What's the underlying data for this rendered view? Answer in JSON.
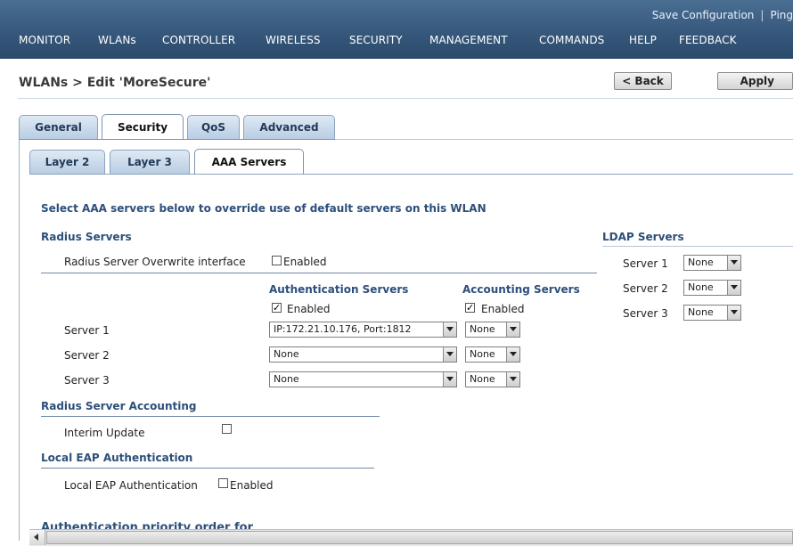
{
  "header": {
    "save_configuration": "Save Configuration",
    "separator": "|",
    "ping": "Ping"
  },
  "menu": [
    "MONITOR",
    "WLANs",
    "CONTROLLER",
    "WIRELESS",
    "SECURITY",
    "MANAGEMENT",
    "COMMANDS",
    "HELP",
    "FEEDBACK"
  ],
  "page": {
    "title": "WLANs > Edit  'MoreSecure'",
    "back_label": "< Back",
    "apply_label": "Apply"
  },
  "tabs": {
    "main": [
      "General",
      "Security",
      "QoS",
      "Advanced"
    ],
    "main_selected": "Security",
    "sub": [
      "Layer 2",
      "Layer 3",
      "AAA Servers"
    ],
    "sub_selected": "AAA Servers"
  },
  "content": {
    "intro": "Select AAA servers below to override use of default servers on this WLAN",
    "radius_title": "Radius Servers",
    "overwrite_label": "Radius Server Overwrite interface",
    "overwrite_checkbox_label": "Enabled",
    "overwrite_checked": false,
    "auth_header": "Authentication Servers",
    "acct_header": "Accounting Servers",
    "auth_enabled_label": "Enabled",
    "auth_enabled_checked": true,
    "acct_enabled_label": "Enabled",
    "acct_enabled_checked": true,
    "servers": [
      {
        "label": "Server 1",
        "auth": "IP:172.21.10.176, Port:1812",
        "acct": "None"
      },
      {
        "label": "Server 2",
        "auth": "None",
        "acct": "None"
      },
      {
        "label": "Server 3",
        "auth": "None",
        "acct": "None"
      }
    ],
    "accounting_title": "Radius Server Accounting",
    "interim_label": "Interim Update",
    "interim_checked": false,
    "eap_title": "Local EAP Authentication",
    "eap_label": "Local EAP Authentication",
    "eap_checkbox_label": "Enabled",
    "eap_checked": false,
    "priority_title": "Authentication priority order for",
    "ldap_title": "LDAP Servers",
    "ldap": [
      {
        "label": "Server 1",
        "value": "None"
      },
      {
        "label": "Server 2",
        "value": "None"
      },
      {
        "label": "Server 3",
        "value": "None"
      }
    ]
  },
  "colors": {
    "header_bg": "#3a5d82",
    "section_text": "#2c4f7a",
    "tab_bg": "#c9d9ea"
  },
  "icons": {
    "checkbox_checked": "check-mark",
    "dropdown": "chevron-down-icon",
    "scroll_left": "arrow-left-icon"
  }
}
